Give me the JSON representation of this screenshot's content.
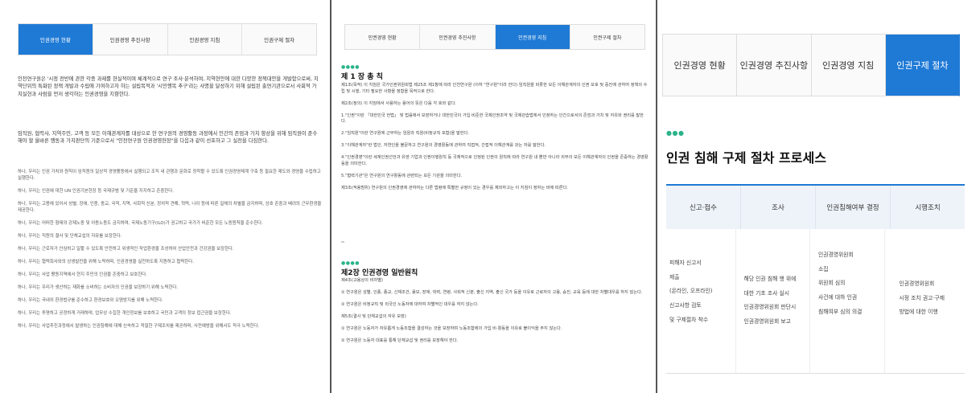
{
  "tabs": [
    "인권경영 현황",
    "인권경영 추진사항",
    "인권경영 지침",
    "인권구제 절차"
  ],
  "panel1": {
    "intro": "인천연구원은 '시정 전반에 관한 각종 과제를 현실적이며 체계적으로 연구 조사·분석하여, 지역현안에 대한 다양한 정책대안을 개발함으로써, 지역단위의 특화된 정책 개발과 수립에 기여하고자 하는 설립목적과 '시민행복 추구'라는 사명을 달성하기 위해 설립된 출연기관으로서 사회적 가치실현과 사람을 먼저 생각하는 인권경영을 지향한다.",
    "lead": "임직원, 협력사, 지역주민, 고객 등 모든 이해관계자를 대상으로 한 연구원의 경영활동 과정에서 인간의 존엄과 가치 향상을 위해 임직원이 준수해야 할 올바른 행동과 가치판단의 기준으로서 \"인천연구원 인권경영헌장\"을 다음과 같이 선포하고 그 실천을 다짐한다.",
    "items": [
      "하나, 우리는 인권 가치와 원칙이 임직원의 일상적 경영활동에서 실행되고 조직 내 관행과 문화로 정착할 수 있도록 인권경영체계 구축 등 필요한 제도와 경영을 수립하고 실행한다.",
      "하나, 우리는 인권에 대한 UN 인권기본헌장 등 국제규범 및 기준을 지지하고 존중한다.",
      "하나, 우리는 고용에 있어서 성별, 장애, 인종, 종교, 국적, 지역, 사회적 신분, 정치적 견해, 혁력, 나이 등에 따른 일체의 차별을 금지하며, 상호 존중과 배려의 근무환경을 제공한다.",
      "하나, 우리는 어떠한 형태의 강제노동 및 아동노동도 금지하며, 국제노동기구(ILO)가 권고하고 국가가 비준한 모든 노동원칙을 준수한다.",
      "하나, 우리는 직원의 결사 및 단체교섭의 자유를 보장한다.",
      "하나, 우리는 근로자가 안심하고 일할 수 있도록 안전하고 위생적인 작업환경을 조성하여 산업안전과 건강권을 보장한다.",
      "하나, 우리는 협력회사와의 상생발전을 위해 노력하며, 인권경영을 실천하도록 지원하고 협력한다.",
      "하나, 우리는 사업 활동지역에서 현지 주민의 인권을 존중하고 보호한다.",
      "하나, 우리는 우리가 생산하는 재화를 소비하는 소비자의 인권을 보장하기 위해 노력한다.",
      "하나, 우리는 국내외 환경법규를 준수하고 환경보호와 오염방지를 위해 노력한다.",
      "하나, 우리는 투명하고 공정하게 거래하며, 업무상 수집한 개인정보를 보호하고 국민과 고객의 정보 접근권을 보장한다.",
      "하나, 우리는 사업추진과정에서 발생하는 인권침해에 대해 신속하고 적절한 구제조치를 제공하며, 사전예방을 위해서도 적극 노력한다."
    ]
  },
  "panel2": {
    "dots": "●●●●",
    "ch1_title": "제 1 장 총 칙",
    "ch1_paras": [
      "제1조(목적) 이 지침은 국가인권위원회법 제25조 제1항에 따라 인천연구원 (이하 \"연구원\"이라 한다) 임직원을 비롯한 모든 이해관계자의 인권 보호 및 증진에 관하여 정책의 수립 및 시행, 기타 필요한 사항을 정함을 목적으로 한다.",
      "제2조(정의) 이 지침에서 사용하는 용어의 뜻은 다음 각 호와 같다.",
      "1.\"인권\"이란 「대한민국 헌법」 및 법률에서 보장하거나 대한민국이 가입·비준한 국제인권조약 및 국제관습법에서 인정하는 인간으로서의 존엄과 가치 및 자유와 권리를 말한다.",
      "2.\"임직원\"이란 연구원에 근무하는 임원과 직원(비정규직 포함)을 말한다.",
      "3.\"이해관계자\"란 법인, 자연인을 불문하고 연구원의 경영활동에 관하여 직접적, 간접적 이해관계를 갖는 자를 말한다.",
      "4.\"인권경영\"이란 세계인권선언과 유엔 기업과 인권이행원칙 등 국제적으로 인정된 인권의 원칙에 따라 연구원 내 뿐만 아니라 외부의 모든 이해관계자의 인권을 존중하는 경영활동을 의미한다.",
      "5.\"협력기관\"은 연구원의 연구활동에 관련되는 모든 기관을 의미한다.",
      "제3조(적용범위) 연구원의 인권경영에 관하여는 다른 법령에 특별한 규정이 있는 경우를 제외하고는 이 지침이 정하는 바에 따른다."
    ],
    "ch2_title": "제2장 인권경영 일반원칙",
    "ch2_paras": [
      "제4조(고용상의 비차별)",
      "① 연구원은 성별, 인종, 종교, 신체조건, 용모, 장애, 학력, 연령, 사회적 신분, 출신 지역, 출신 국가 등을 이유로 근로자의 고용, 승진, 교육 등에 대한 차별대우를 하지 않는다.",
      "② 연구원은 비정규직 및 외국인 노동자에 대하여 차별적인 대우를 하지 않는다.",
      "제5조(결사 및 단체교섭의 자유 보장)",
      "① 연구원은 노동자가 자유롭게 노동조합을 결성하는 것을 보장하며 노동조합에의 가입 비·활동을 이유로 불이익을 주지 않는다.",
      "② 연구원은 노동자 대표를 통해 단체교섭 및 권리를 보장해야 한다."
    ]
  },
  "panel3": {
    "dots": "●●●",
    "title": "인권 침해 구제 절차 프로세스",
    "headers": [
      "신고·접수",
      "조사",
      "인권침해여부 결정",
      "시행조치"
    ],
    "col1": [
      "피해자 신고서",
      "제출",
      "(온라인, 오프라인)",
      "신고사항 검토",
      "및 구제절차 착수"
    ],
    "col2": [
      "해당 인권 침해 행 위에",
      "대한 기초 조사 실시",
      "인권경영위원회 판단시",
      "인권경영위원회 보고"
    ],
    "col3": [
      "인권경영위원회",
      "소집",
      "위원회 심의",
      "사건에 대하 인권",
      "침해여부 심의 의결"
    ],
    "col4": [
      "인권경영위원회",
      "시정 조치 권고·구제",
      "방법에 대한 이행"
    ]
  },
  "accent": "#1f7ad6"
}
